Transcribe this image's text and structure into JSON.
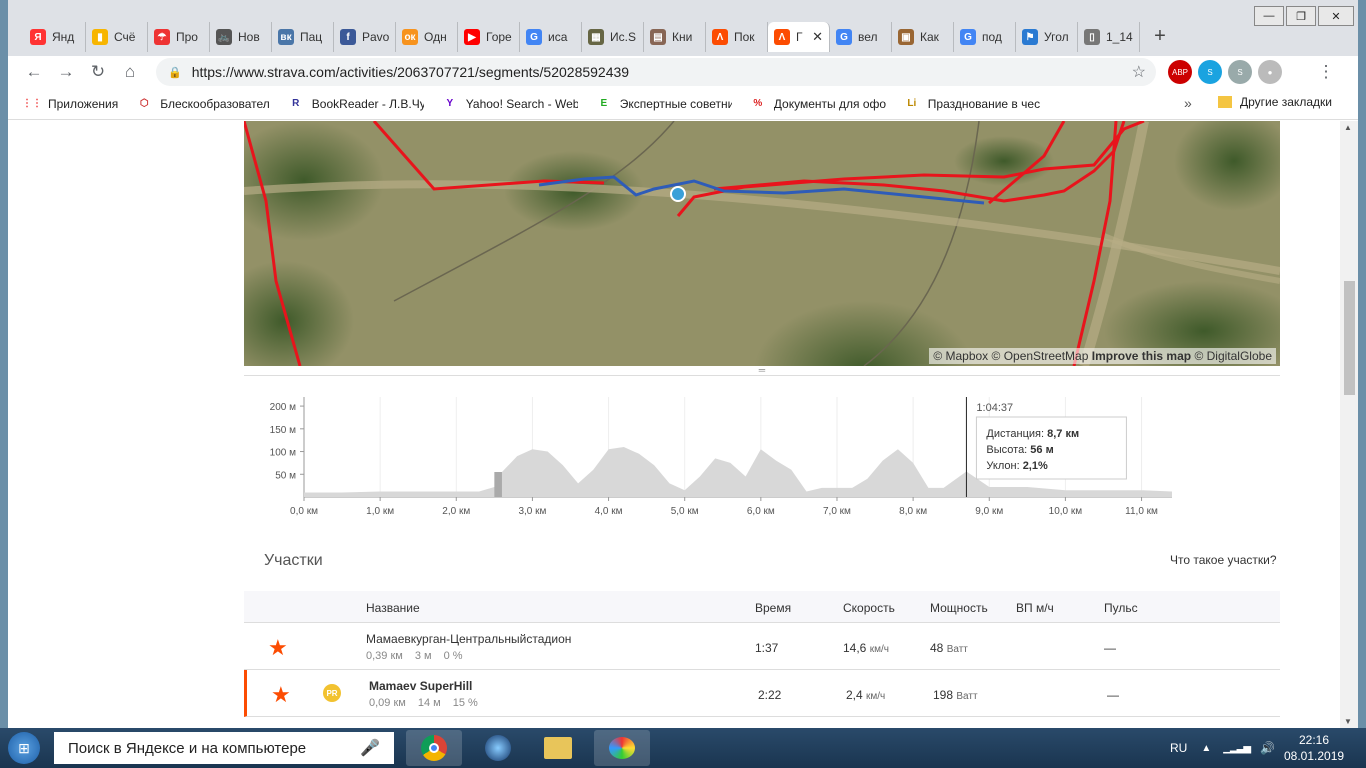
{
  "window_controls": {
    "minimize": "—",
    "restore": "❐",
    "close": "✕"
  },
  "tabs": [
    {
      "label": "Янд",
      "icon": "Я",
      "color": "#f33"
    },
    {
      "label": "Счё",
      "icon": "▮",
      "color": "#f7b500"
    },
    {
      "label": "Про",
      "icon": "☂",
      "color": "#e33"
    },
    {
      "label": "Нов",
      "icon": "🚲",
      "color": "#555"
    },
    {
      "label": "Пац",
      "icon": "вк",
      "color": "#4a76a8"
    },
    {
      "label": "Pavo",
      "icon": "f",
      "color": "#3b5998"
    },
    {
      "label": "Одн",
      "icon": "ок",
      "color": "#f7931e"
    },
    {
      "label": "Горе",
      "icon": "▶",
      "color": "#f00"
    },
    {
      "label": "иса",
      "icon": "G",
      "color": "#4285f4"
    },
    {
      "label": "Ис.S",
      "icon": "▦",
      "color": "#664"
    },
    {
      "label": "Кни",
      "icon": "▤",
      "color": "#865"
    },
    {
      "label": "Пок",
      "icon": "Λ",
      "color": "#fc4c02"
    },
    {
      "label": "Г",
      "icon": "Λ",
      "color": "#fc4c02",
      "active": true
    },
    {
      "label": "вел",
      "icon": "G",
      "color": "#4285f4"
    },
    {
      "label": "Как",
      "icon": "▣",
      "color": "#963"
    },
    {
      "label": "под",
      "icon": "G",
      "color": "#4285f4"
    },
    {
      "label": "Угол",
      "icon": "⚑",
      "color": "#2a7ad2"
    },
    {
      "label": "1_14",
      "icon": "▯",
      "color": "#777"
    }
  ],
  "new_tab": "+",
  "toolbar": {
    "back": "←",
    "forward": "→",
    "reload": "↻",
    "home": "⌂",
    "lock": "🔒",
    "url": "https://www.strava.com/activities/2063707721/segments/52028592439",
    "star": "☆",
    "menu": "⋮"
  },
  "extensions": [
    {
      "label": "ABP",
      "color": "#c00"
    },
    {
      "label": "S",
      "color": "#1aa3e0"
    },
    {
      "label": "S",
      "color": "#9aa"
    },
    {
      "label": "●",
      "color": "#bbb"
    }
  ],
  "bookmarks": [
    {
      "label": "Приложения",
      "icon": "⋮⋮",
      "color": "#e44"
    },
    {
      "label": "Блескообразовател",
      "icon": "⬡",
      "color": "#c33"
    },
    {
      "label": "BookReader - Л.В.Чу",
      "icon": "R",
      "color": "#339"
    },
    {
      "label": "Yahoo! Search - Web",
      "icon": "Y",
      "color": "#60c"
    },
    {
      "label": "Экспертные советни",
      "icon": "E",
      "color": "#2a2"
    },
    {
      "label": "Документы для офо",
      "icon": "%",
      "color": "#d22"
    },
    {
      "label": "Празднование в чес",
      "icon": "Li",
      "color": "#b80"
    }
  ],
  "bookmarks_more": "»",
  "bookmarks_other": "Другие закладки",
  "map": {
    "attribution_prefix": "© Mapbox © OpenStreetMap ",
    "attribution_bold": "Improve this map",
    "attribution_suffix": " © DigitalGlobe"
  },
  "handle": "═",
  "chart_data": {
    "type": "area",
    "x": [
      0,
      0.5,
      1,
      1.5,
      2,
      2.3,
      2.5,
      2.6,
      2.8,
      3.0,
      3.2,
      3.4,
      3.6,
      3.8,
      4.0,
      4.2,
      4.4,
      4.6,
      4.8,
      5.0,
      5.2,
      5.4,
      5.6,
      5.8,
      6.0,
      6.2,
      6.4,
      6.6,
      6.8,
      7.0,
      7.2,
      7.4,
      7.6,
      7.8,
      8.0,
      8.2,
      8.4,
      8.7,
      9.0,
      9.5,
      10,
      10.5,
      11.0,
      11.4
    ],
    "values": [
      10,
      10,
      12,
      12,
      12,
      12,
      22,
      55,
      90,
      105,
      100,
      70,
      30,
      60,
      105,
      110,
      95,
      70,
      30,
      15,
      45,
      85,
      75,
      45,
      105,
      80,
      60,
      12,
      20,
      20,
      20,
      40,
      80,
      105,
      75,
      20,
      20,
      56,
      22,
      22,
      15,
      15,
      15,
      12
    ],
    "xlabel": "",
    "ylabel": "",
    "xticks": [
      "0,0 км",
      "1,0 км",
      "2,0 км",
      "3,0 км",
      "4,0 км",
      "5,0 км",
      "6,0 км",
      "7,0 км",
      "8,0 км",
      "9,0 км",
      "10,0 км",
      "11,0 км"
    ],
    "yticks": [
      "50 м",
      "100 м",
      "150 м",
      "200 м"
    ],
    "xlim": [
      0,
      11.4
    ],
    "ylim": [
      0,
      220
    ],
    "highlight_segment": [
      2.5,
      2.6
    ],
    "cursor": {
      "x": 8.7,
      "time": "1:04:37",
      "dist_label": "Дистанция: ",
      "dist_val": "8,7 км",
      "elev_label": "Высота: ",
      "elev_val": "56 м",
      "grade_label": "Уклон: ",
      "grade_val": "2,1%"
    },
    "grid": true
  },
  "segments": {
    "title": "Участки",
    "help": "Что такое участки?",
    "headers": {
      "name": "Название",
      "time": "Время",
      "speed": "Скорость",
      "power": "Мощность",
      "vp": "ВП м/ч",
      "hr": "Пульс"
    },
    "rows": [
      {
        "name": "Мамаевкурган-Центральныйстадион",
        "dist": "0,39 км",
        "elev": "3 м",
        "grade": "0 %",
        "time": "1:37",
        "speed": "14,6",
        "speed_unit": "км/ч",
        "power": "48",
        "power_unit": "Ватт",
        "hr": "—",
        "pr": false,
        "star": "★"
      },
      {
        "name": "Mamaev SuperHill",
        "dist": "0,09 км",
        "elev": "14 м",
        "grade": "15 %",
        "time": "2:22",
        "speed": "2,4",
        "speed_unit": "км/ч",
        "power": "198",
        "power_unit": "Ватт",
        "hr": "—",
        "pr": true,
        "badge": "PR",
        "star": "★"
      }
    ]
  },
  "taskbar": {
    "start": "⊞",
    "search": "Поиск в Яндексе и на компьютере",
    "mic": "🎤",
    "lang": "RU",
    "time": "22:16",
    "date": "08.01.2019"
  }
}
